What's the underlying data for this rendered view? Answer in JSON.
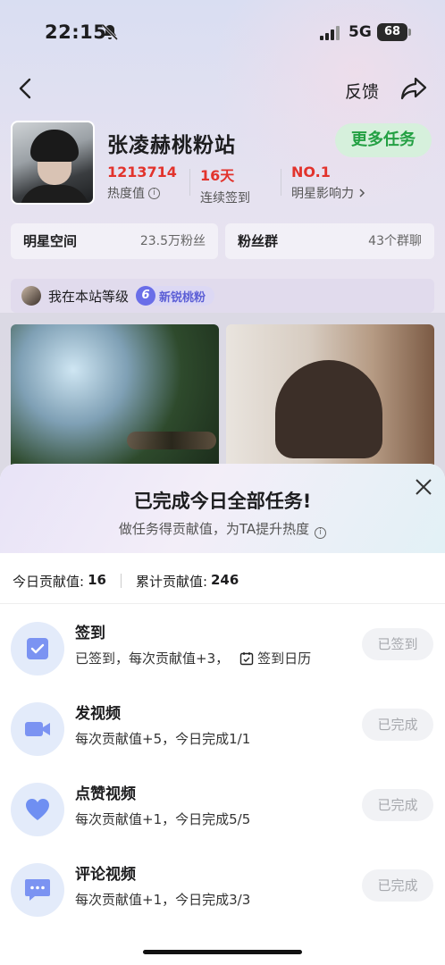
{
  "status_bar": {
    "time": "22:15",
    "network": "5G",
    "battery": "68"
  },
  "nav": {
    "feedback": "反馈"
  },
  "profile": {
    "name": "张凌赫桃粉站",
    "more_tasks": "更多任务",
    "stats": [
      {
        "value": "1213714",
        "label": "热度值"
      },
      {
        "value": "16天",
        "label": "连续签到"
      },
      {
        "value": "NO.1",
        "label": "明星影响力"
      }
    ]
  },
  "cards": [
    {
      "title": "明星空间",
      "right": "23.5万粉丝"
    },
    {
      "title": "粉丝群",
      "right": "43个群聊"
    }
  ],
  "level": {
    "label": "我在本站等级",
    "number": "6",
    "badge": "新锐桃粉"
  },
  "sheet": {
    "title": "已完成今日全部任务!",
    "subtitle": "做任务得贡献值，为TA提升热度",
    "today_label": "今日贡献值:",
    "today_value": "16",
    "total_label": "累计贡献值:",
    "total_value": "246",
    "tasks": [
      {
        "name": "签到",
        "desc": "已签到，每次贡献值+3，",
        "extra": "签到日历",
        "button": "已签到",
        "icon": "checkbox-icon"
      },
      {
        "name": "发视频",
        "desc": "每次贡献值+5，今日完成1/1",
        "button": "已完成",
        "icon": "video-camera-icon"
      },
      {
        "name": "点赞视频",
        "desc": "每次贡献值+1，今日完成5/5",
        "button": "已完成",
        "icon": "heart-icon"
      },
      {
        "name": "评论视频",
        "desc": "每次贡献值+1，今日完成3/3",
        "button": "已完成",
        "icon": "comment-icon"
      }
    ]
  },
  "colors": {
    "accent_red": "#e2332c",
    "green": "#23a043",
    "task_icon": "#6f8ff2",
    "badge": "#6a6ee8"
  }
}
